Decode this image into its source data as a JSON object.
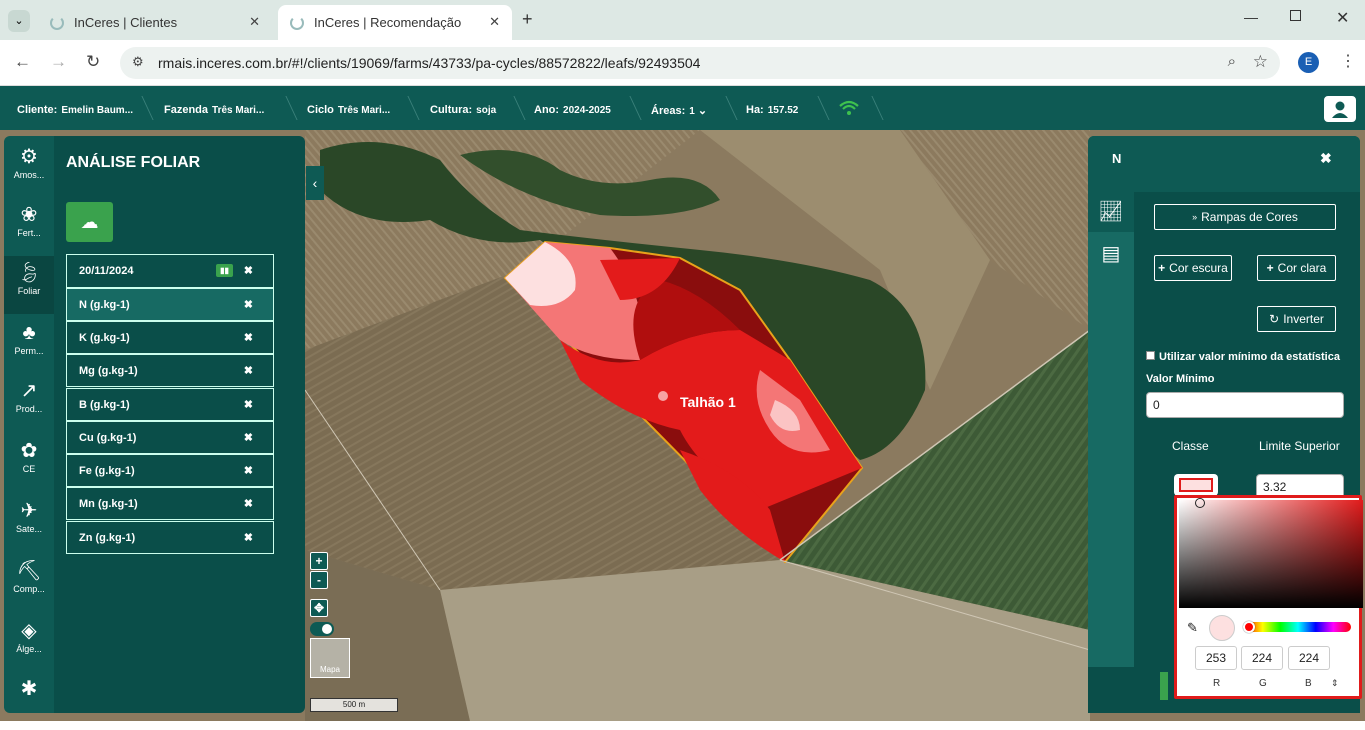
{
  "browser": {
    "tabs": [
      {
        "title": "InCeres | Clientes"
      },
      {
        "title": "InCeres | Recomendação"
      }
    ],
    "url": "rmais.inceres.com.br/#!/clients/19069/farms/43733/pa-cycles/88572822/leafs/92493504",
    "profile_initial": "E"
  },
  "appbar": {
    "cliente_label": "Cliente:",
    "cliente_value": "Emelin Baum...",
    "fazenda_label": "Fazenda",
    "fazenda_value": "Três Mari...",
    "ciclo_label": "Ciclo",
    "ciclo_value": "Três Mari...",
    "cultura_label": "Cultura:",
    "cultura_value": "soja",
    "ano_label": "Ano:",
    "ano_value": "2024-2025",
    "areas_label": "Áreas:",
    "areas_value": "1",
    "ha_label": "Ha:",
    "ha_value": "157.52"
  },
  "rail": [
    {
      "label": "Amos...",
      "icon": "samples-icon"
    },
    {
      "label": "Fert...",
      "icon": "fertility-icon"
    },
    {
      "label": "Foliar",
      "icon": "leaf-icon"
    },
    {
      "label": "Perm...",
      "icon": "perennial-icon"
    },
    {
      "label": "Prod...",
      "icon": "productivity-icon"
    },
    {
      "label": "CE",
      "icon": "conductivity-icon"
    },
    {
      "label": "Sate...",
      "icon": "satellite-icon"
    },
    {
      "label": "Comp...",
      "icon": "compaction-icon"
    },
    {
      "label": "Álge...",
      "icon": "layers-icon"
    },
    {
      "label": "",
      "icon": "bug-icon"
    }
  ],
  "panel": {
    "title": "ANÁLISE FOLIAR",
    "date": "20/11/2024",
    "nutrients": [
      "N (g.kg-1)",
      "K (g.kg-1)",
      "Mg (g.kg-1)",
      "B (g.kg-1)",
      "Cu (g.kg-1)",
      "Fe (g.kg-1)",
      "Mn (g.kg-1)",
      "Zn (g.kg-1)"
    ]
  },
  "map": {
    "field_label": "Talhão 1",
    "zoom_in": "+",
    "zoom_out": "-",
    "basemap_label": "Mapa",
    "scale": "500 m"
  },
  "right_panel": {
    "title": "N",
    "ramp_button": "Rampas de Cores",
    "dark_button": "Cor escura",
    "light_button": "Cor clara",
    "invert_button": "Inverter",
    "use_min_label": "Utilizar valor mínimo da estatística",
    "min_label": "Valor Mínimo",
    "min_value": "0",
    "class_header": "Classe",
    "upper_header": "Limite Superior",
    "upper_value": "3.32"
  },
  "picker": {
    "r": "253",
    "g": "224",
    "b": "224",
    "r_label": "R",
    "g_label": "G",
    "b_label": "B",
    "swatch": "#fde0e0"
  },
  "colors": {
    "brand_dark": "#0e5a54",
    "accent_green": "#3aa24d",
    "picker_border": "#e01b1b"
  }
}
